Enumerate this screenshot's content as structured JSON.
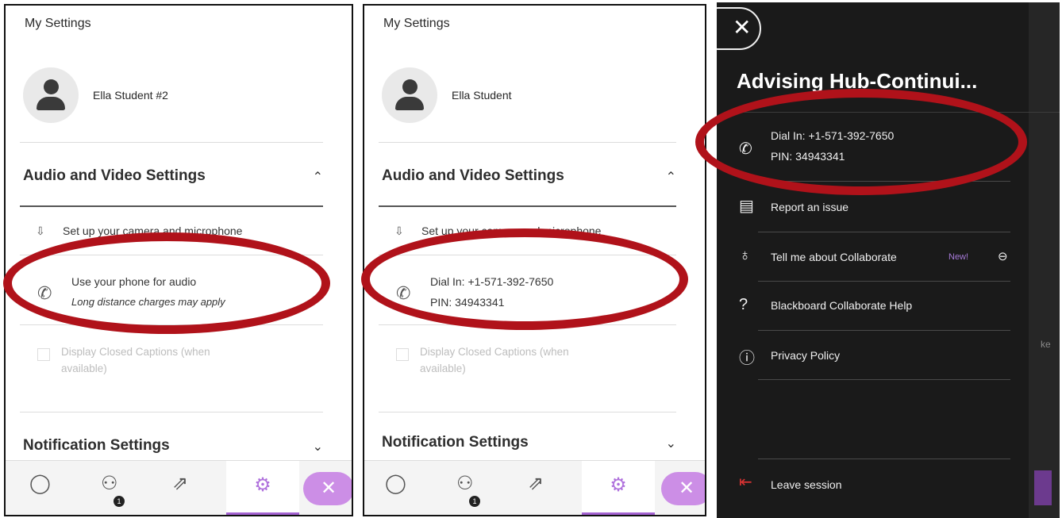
{
  "panel1": {
    "title": "My Settings",
    "user_name": "Ella Student #2",
    "audio_video_heading": "Audio and Video Settings",
    "setup_label": "Set up your camera and microphone",
    "phone_line1": "Use your phone for audio",
    "phone_line2": "Long distance charges may apply",
    "captions_label": "Display Closed Captions (when available)",
    "notification_heading": "Notification Settings",
    "participants_badge": "1"
  },
  "panel2": {
    "title": "My Settings",
    "user_name": "Ella Student",
    "audio_video_heading": "Audio and Video Settings",
    "setup_label": "Set up your camera and microphone",
    "dial_in": "Dial In: +1-571-392-7650",
    "pin": "PIN: 34943341",
    "captions_label": "Display Closed Captions (when available)",
    "notification_heading": "Notification Settings",
    "participants_badge": "1"
  },
  "panel3": {
    "title": "Advising Hub-Continui...",
    "dial_in": "Dial In: +1-571-392-7650",
    "pin": "PIN: 34943341",
    "menu": [
      "Report an issue",
      "Tell me about Collaborate",
      "Blackboard Collaborate Help",
      "Privacy Policy"
    ],
    "new_tag": "New!",
    "leave_label": "Leave session",
    "partial_text": "ke"
  },
  "icons": {
    "close": "close-icon",
    "chat": "chat-icon",
    "participants": "participants-icon",
    "share": "share-icon",
    "settings": "gear-icon",
    "phone": "phone-icon",
    "camera_mic": "camera-mic-icon",
    "report": "report-icon",
    "lightbulb": "lightbulb-icon",
    "help": "help-icon",
    "info": "info-icon",
    "leave": "leave-icon"
  },
  "colors": {
    "accent": "#a463d2",
    "highlight_ring": "#b0121a",
    "dark_bg": "#1a1a1a"
  }
}
